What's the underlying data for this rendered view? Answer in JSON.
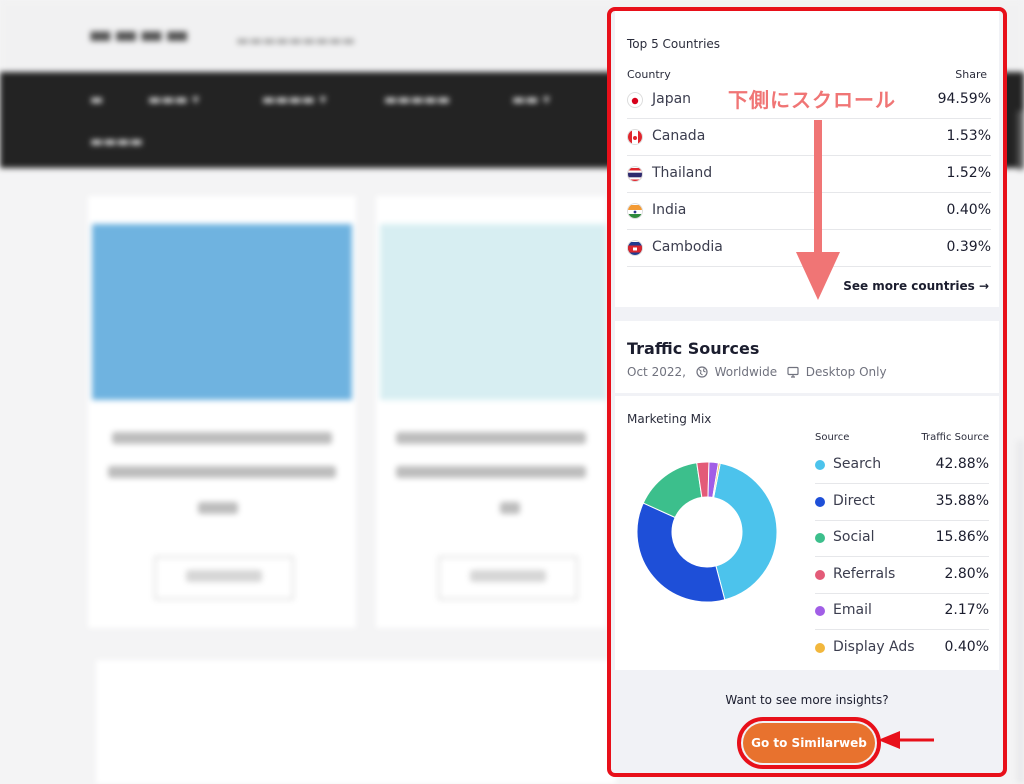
{
  "countries": {
    "title": "Top 5 Countries",
    "col_country": "Country",
    "col_share": "Share",
    "rows": [
      {
        "name": "Japan",
        "share": "94.59%",
        "flag": "japan-flag-icon"
      },
      {
        "name": "Canada",
        "share": "1.53%",
        "flag": "canada-flag-icon"
      },
      {
        "name": "Thailand",
        "share": "1.52%",
        "flag": "thailand-flag-icon"
      },
      {
        "name": "India",
        "share": "0.40%",
        "flag": "india-flag-icon"
      },
      {
        "name": "Cambodia",
        "share": "0.39%",
        "flag": "cambodia-flag-icon"
      }
    ],
    "see_more": "See more countries →"
  },
  "traffic": {
    "title": "Traffic Sources",
    "date": "Oct 2022,",
    "region": "Worldwide",
    "device": "Desktop Only"
  },
  "mix": {
    "title": "Marketing Mix",
    "col_source": "Source",
    "col_traffic": "Traffic Source"
  },
  "chart_data": {
    "type": "pie",
    "title": "Marketing Mix",
    "categories": [
      "Search",
      "Direct",
      "Social",
      "Referrals",
      "Email",
      "Display Ads"
    ],
    "labels": [
      "42.88%",
      "35.88%",
      "15.86%",
      "2.80%",
      "2.17%",
      "0.40%"
    ],
    "values": [
      42.88,
      35.88,
      15.86,
      2.8,
      2.17,
      0.4
    ],
    "colors": [
      "#4cc3ec",
      "#1e4fd8",
      "#3cbf8c",
      "#e35b78",
      "#a15ee6",
      "#f2b73c"
    ],
    "donut": true,
    "legend": "right"
  },
  "footer": {
    "insights": "Want to see more insights?",
    "cta_label": "Go to Similarweb"
  },
  "annotation": {
    "scroll_text": "下側にスクロール",
    "color": "#f07575",
    "highlight_color": "#e8101a"
  },
  "colors": {
    "accent": "#e8722e",
    "panel_border": "#e8101a"
  }
}
